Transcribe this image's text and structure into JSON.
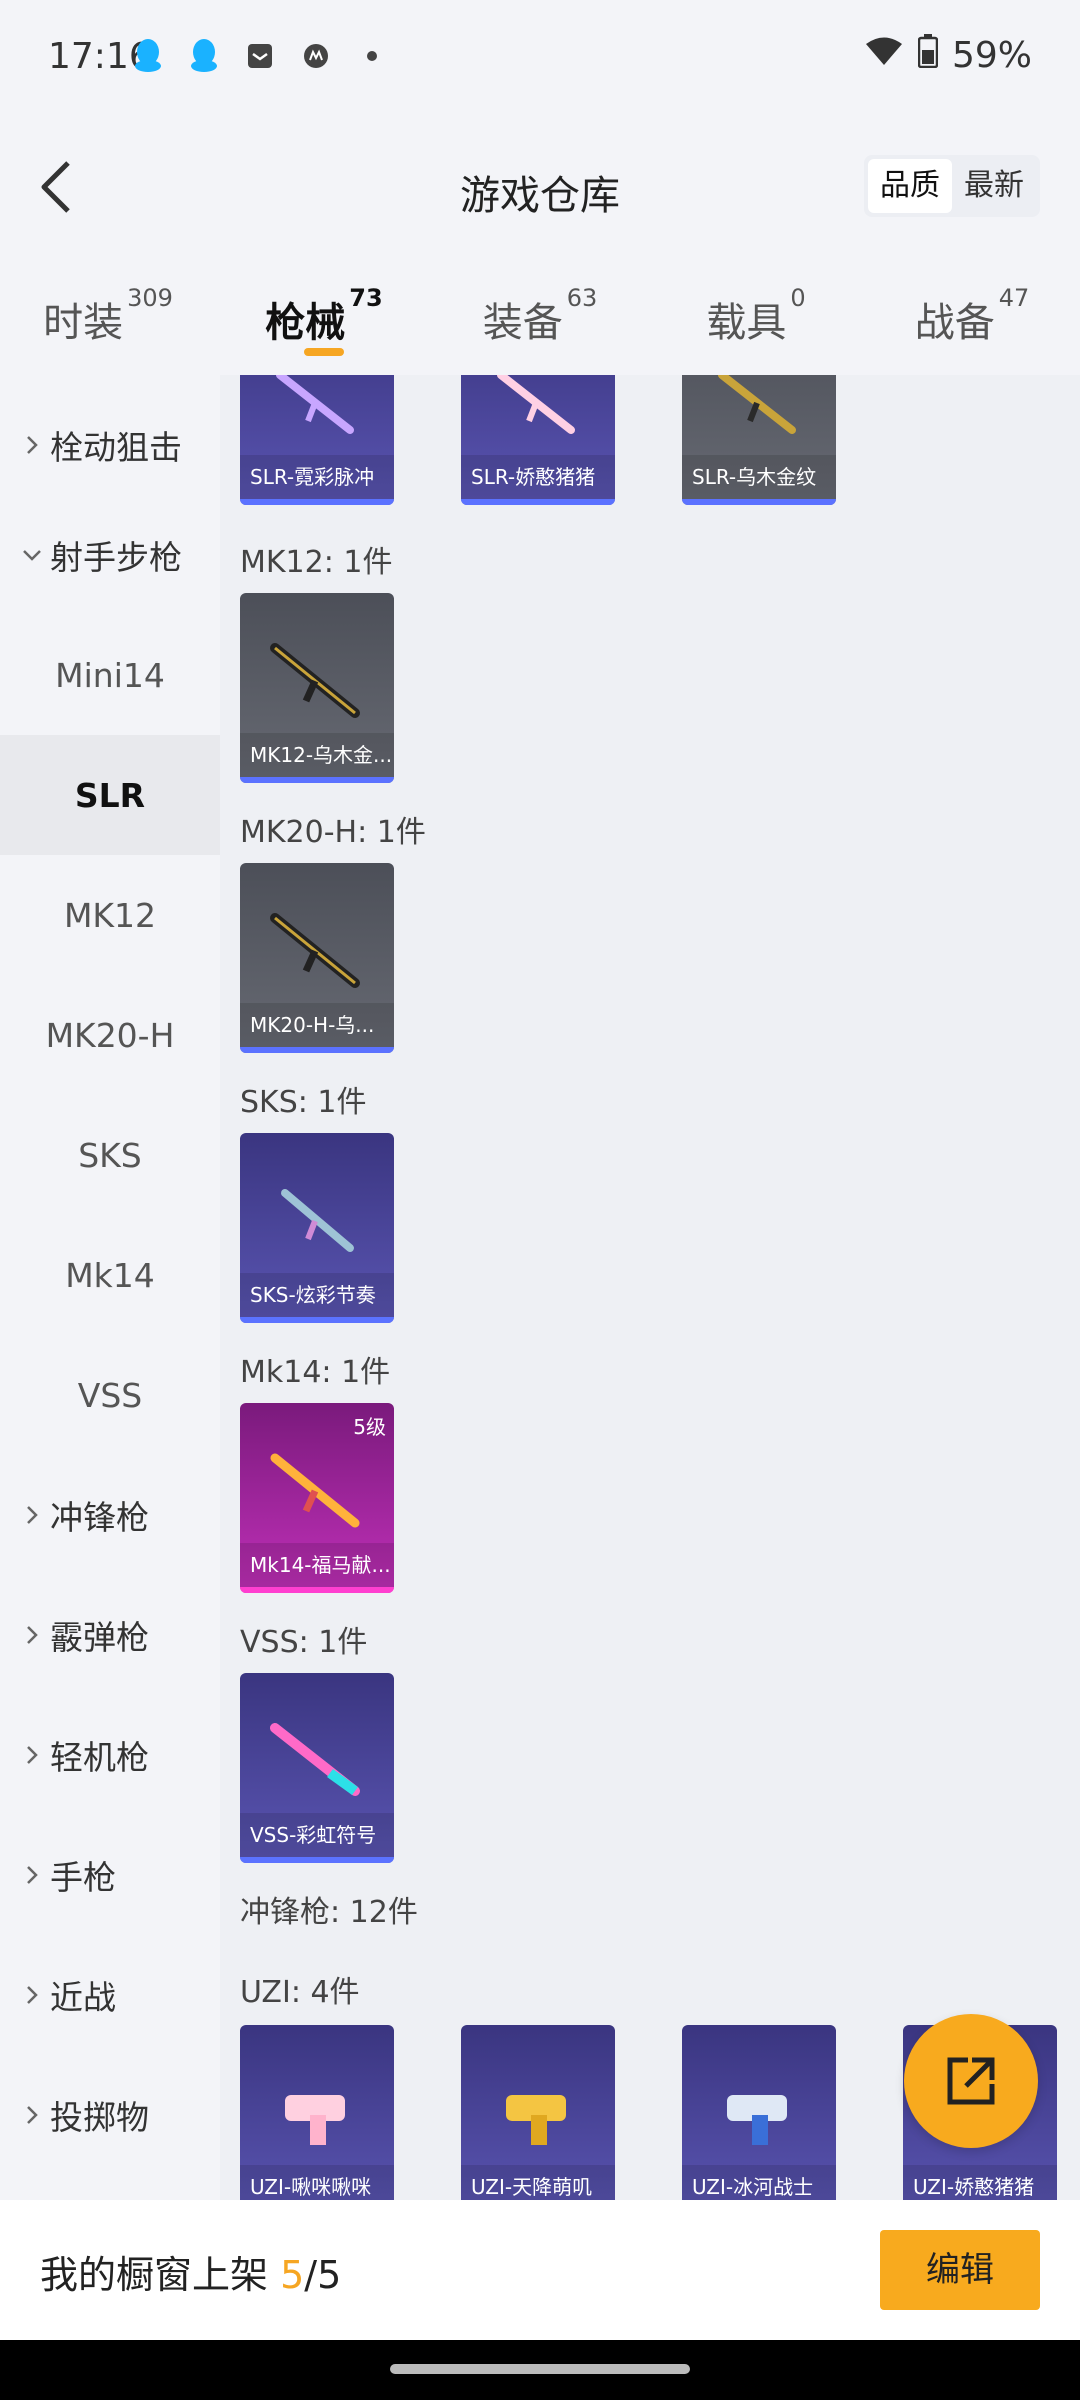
{
  "status_bar": {
    "time": "17:16",
    "battery": "59%"
  },
  "header": {
    "title": "游戏仓库",
    "sort_options": [
      "品质",
      "最新"
    ],
    "sort_active": "品质"
  },
  "tabs": [
    {
      "label": "时装",
      "count": "309"
    },
    {
      "label": "枪械",
      "count": "73"
    },
    {
      "label": "装备",
      "count": "63"
    },
    {
      "label": "载具",
      "count": "0"
    },
    {
      "label": "战备",
      "count": "47"
    }
  ],
  "sidebar": {
    "items": [
      {
        "label": "栓动狙击",
        "type": "group",
        "expanded": false
      },
      {
        "label": "射手步枪",
        "type": "group",
        "expanded": true
      },
      {
        "label": "Mini14",
        "type": "child"
      },
      {
        "label": "SLR",
        "type": "child",
        "active": true
      },
      {
        "label": "MK12",
        "type": "child"
      },
      {
        "label": "MK20-H",
        "type": "child"
      },
      {
        "label": "SKS",
        "type": "child"
      },
      {
        "label": "Mk14",
        "type": "child"
      },
      {
        "label": "VSS",
        "type": "child"
      },
      {
        "label": "冲锋枪",
        "type": "group",
        "expanded": false
      },
      {
        "label": "霰弹枪",
        "type": "group",
        "expanded": false
      },
      {
        "label": "轻机枪",
        "type": "group",
        "expanded": false
      },
      {
        "label": "手枪",
        "type": "group",
        "expanded": false
      },
      {
        "label": "近战",
        "type": "group",
        "expanded": false
      },
      {
        "label": "投掷物",
        "type": "group",
        "expanded": false
      }
    ]
  },
  "content": {
    "slr_cards": [
      "SLR-霓彩脉冲",
      "SLR-娇憨猪猪",
      "SLR-乌木金纹"
    ],
    "sections": [
      {
        "title": "MK12: 1件",
        "cards": [
          {
            "name": "MK12-乌木金...",
            "style": "gray"
          }
        ]
      },
      {
        "title": "MK20-H: 1件",
        "cards": [
          {
            "name": "MK20-H-乌...",
            "style": "gray"
          }
        ]
      },
      {
        "title": "SKS: 1件",
        "cards": [
          {
            "name": "SKS-炫彩节奏",
            "style": "purple"
          }
        ]
      },
      {
        "title": "Mk14: 1件",
        "cards": [
          {
            "name": "Mk14-福马献...",
            "style": "pink",
            "level": "5级"
          }
        ]
      },
      {
        "title": "VSS: 1件",
        "cards": [
          {
            "name": "VSS-彩虹符号",
            "style": "purple"
          }
        ]
      }
    ],
    "smg_header": "冲锋枪: 12件",
    "uzi_header": "UZI: 4件",
    "uzi_cards": [
      "UZI-啾咪啾咪",
      "UZI-天降萌叽",
      "UZI-冰河战士",
      "UZI-娇憨猪猪"
    ]
  },
  "footer": {
    "shelf_label": "我的橱窗上架",
    "shelf_used": "5",
    "shelf_sep": "/",
    "shelf_total": "5",
    "edit_label": "编辑"
  }
}
